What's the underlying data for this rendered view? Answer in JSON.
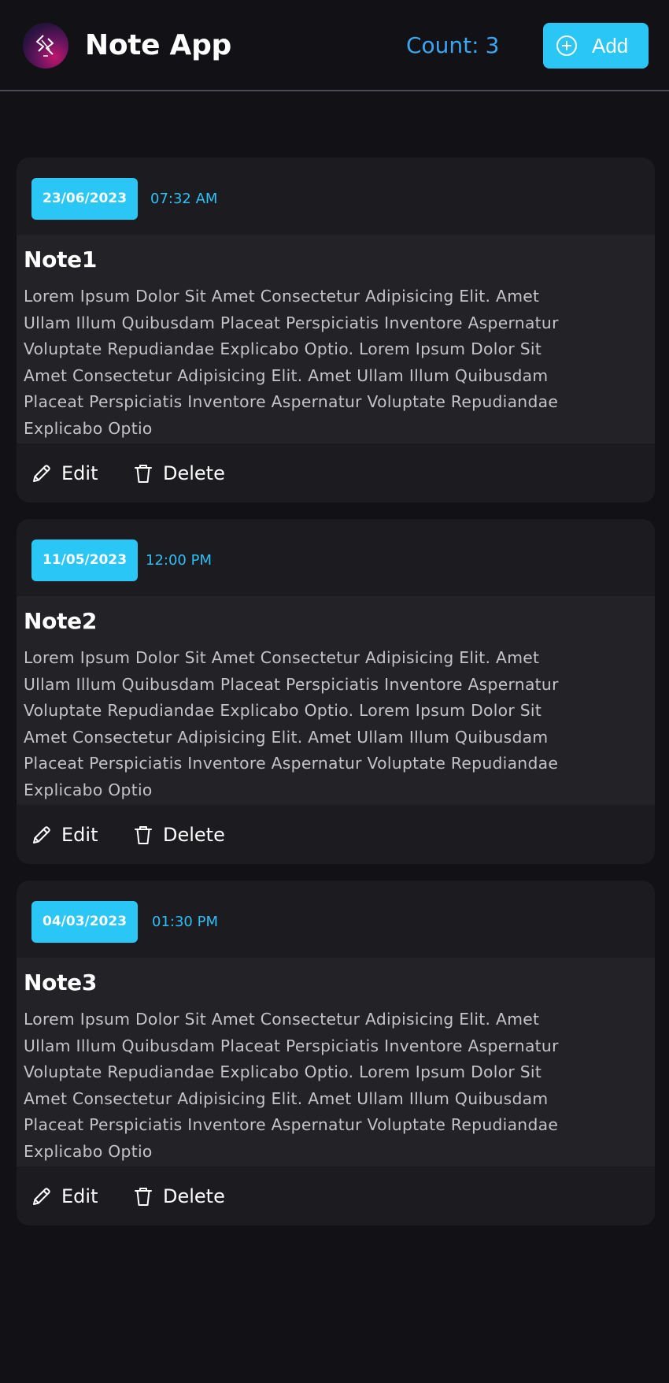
{
  "header": {
    "title": "Note App",
    "count_label": "Count:",
    "count_value": "3",
    "add_label": "Add",
    "logo_icon": "app-logo-icon",
    "add_icon": "plus-circle-icon"
  },
  "colors": {
    "accent": "#29c6f6",
    "count_text": "#3aa6f2",
    "background": "#121216",
    "card": "#1b1b20",
    "card_body": "#222227"
  },
  "notes": [
    {
      "date": "23/06/2023",
      "time": "07:32 AM",
      "title": "Note1",
      "body": "Lorem Ipsum Dolor Sit Amet Consectetur Adipisicing Elit. Amet\nUllam Illum Quibusdam Placeat Perspiciatis Inventore Aspernatur\nVoluptate Repudiandae Explicabo Optio. Lorem Ipsum Dolor Sit\nAmet Consectetur Adipisicing Elit. Amet Ullam Illum Quibusdam\nPlaceat Perspiciatis Inventore Aspernatur Voluptate Repudiandae\nExplicabo Optio",
      "edit_label": "Edit",
      "delete_label": "Delete"
    },
    {
      "date": "11/05/2023",
      "time": "12:00 PM",
      "title": "Note2",
      "body": "Lorem Ipsum Dolor Sit Amet Consectetur Adipisicing Elit. Amet\nUllam Illum Quibusdam Placeat Perspiciatis Inventore Aspernatur\nVoluptate Repudiandae Explicabo Optio. Lorem Ipsum Dolor Sit\nAmet Consectetur Adipisicing Elit. Amet Ullam Illum Quibusdam\nPlaceat Perspiciatis Inventore Aspernatur Voluptate Repudiandae\nExplicabo Optio",
      "edit_label": "Edit",
      "delete_label": "Delete"
    },
    {
      "date": "04/03/2023",
      "time": "01:30 PM",
      "title": "Note3",
      "body": "Lorem Ipsum Dolor Sit Amet Consectetur Adipisicing Elit. Amet\nUllam Illum Quibusdam Placeat Perspiciatis Inventore Aspernatur\nVoluptate Repudiandae Explicabo Optio. Lorem Ipsum Dolor Sit\nAmet Consectetur Adipisicing Elit. Amet Ullam Illum Quibusdam\nPlaceat Perspiciatis Inventore Aspernatur Voluptate Repudiandae\nExplicabo Optio",
      "edit_label": "Edit",
      "delete_label": "Delete"
    }
  ]
}
